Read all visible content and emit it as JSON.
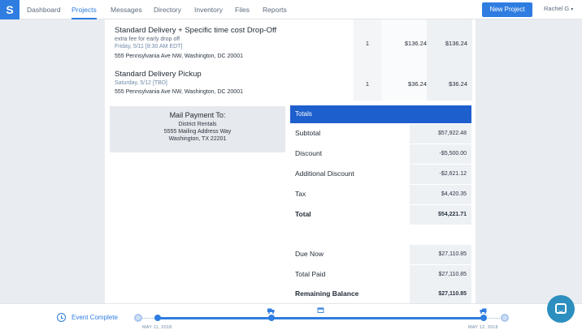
{
  "nav": {
    "logo": "S",
    "items": [
      "Dashboard",
      "Projects",
      "Messages",
      "Directory",
      "Inventory",
      "Files",
      "Reports"
    ],
    "active": "Projects",
    "new_project": "New Project",
    "user": "Rachel G"
  },
  "line_items": [
    {
      "title": "Standard Delivery + Specific time cost Drop-Off",
      "note": "extra fee for early drop off",
      "date": "Friday, 5/11  [8:30 AM EDT]",
      "address": "555 Pennsylvania Ave NW, Washington, DC 20001",
      "qty": "1",
      "price": "$136.24",
      "total": "$136.24"
    },
    {
      "title": "Standard Delivery Pickup",
      "date": "Saturday, 5/12  [TBD]",
      "address": "555 Pennsylvania Ave NW, Washington, DC 20001",
      "qty": "1",
      "price": "$36.24",
      "total": "$36.24"
    }
  ],
  "mail_payment": {
    "title": "Mail Payment To:",
    "name": "District Rentals",
    "street": "5555 Mailing Address Way",
    "city": "Washington, TX 22201"
  },
  "totals": {
    "header": "Totals",
    "rows": [
      {
        "label": "Subtotal",
        "value": "$57,922.48"
      },
      {
        "label": "Discount",
        "value": "-$5,500.00"
      },
      {
        "label": "Additional Discount",
        "value": "-$2,621.12"
      },
      {
        "label": "Tax",
        "value": "$4,420.35"
      },
      {
        "label": "Total",
        "value": "$54,221.71"
      }
    ],
    "payment_rows": [
      {
        "label": "Due Now",
        "value": "$27,110.85"
      },
      {
        "label": "Total Paid",
        "value": "$27,110.85"
      },
      {
        "label": "Remaining Balance",
        "value": "$27,110.85"
      }
    ]
  },
  "timeline": {
    "label": "Event Complete",
    "start_date": "MAY 11, 2018",
    "end_date": "MAY 12, 2018"
  },
  "colors": {
    "accent": "#2f7de1",
    "totals_header": "#1d5fcc",
    "chat": "#2d8fbf"
  }
}
